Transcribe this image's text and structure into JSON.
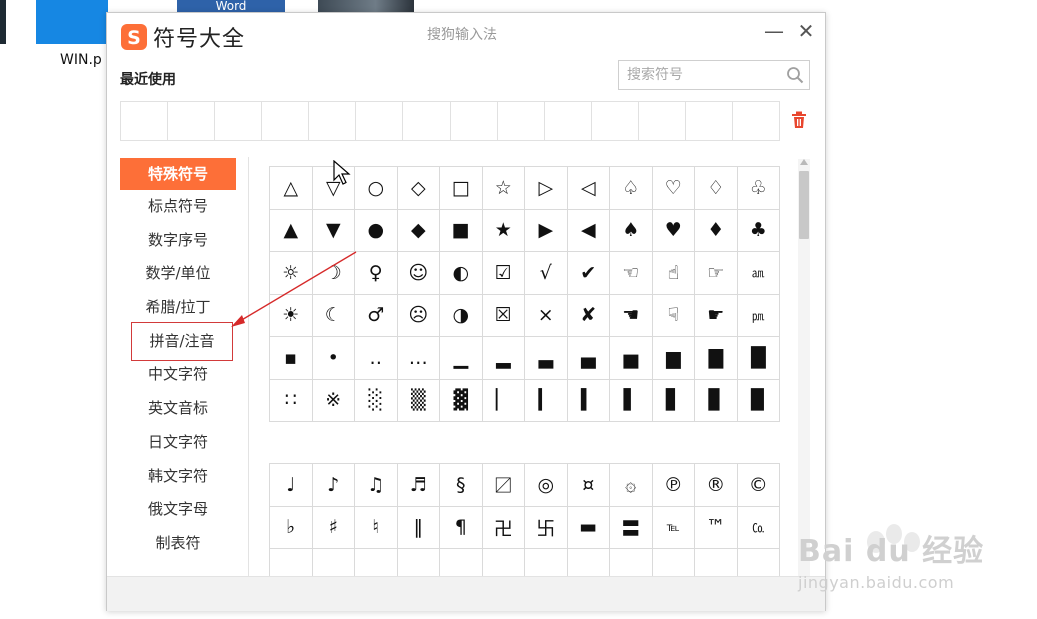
{
  "desktop": {
    "word_tile_label": "Word",
    "win_caption": "WIN.p"
  },
  "window": {
    "title": "符号大全",
    "source": "搜狗输入法",
    "minimize_label": "—",
    "close_label": "✕",
    "accent_color": "#fd6f38"
  },
  "recent": {
    "label": "最近使用",
    "cell_count": 14
  },
  "search": {
    "placeholder": "搜索符号",
    "value": ""
  },
  "categories": [
    {
      "label": "特殊符号",
      "active": true
    },
    {
      "label": "标点符号"
    },
    {
      "label": "数字序号"
    },
    {
      "label": "数学/单位"
    },
    {
      "label": "希腊/拉丁"
    },
    {
      "label": "拼音/注音",
      "highlighted": true
    },
    {
      "label": "中文字符"
    },
    {
      "label": "英文音标"
    },
    {
      "label": "日文字符"
    },
    {
      "label": "韩文字符"
    },
    {
      "label": "俄文字母"
    },
    {
      "label": "制表符"
    }
  ],
  "symbols_block1": [
    [
      "△",
      "▽",
      "○",
      "◇",
      "□",
      "☆",
      "▷",
      "◁",
      "♤",
      "♡",
      "♢",
      "♧"
    ],
    [
      "▲",
      "▼",
      "●",
      "◆",
      "■",
      "★",
      "▶",
      "◀",
      "♠",
      "♥",
      "♦",
      "♣"
    ],
    [
      "☼",
      "☽",
      "♀",
      "☺",
      "◐",
      "☑",
      "√",
      "✔",
      "☜",
      "☝",
      "☞",
      "㏂"
    ],
    [
      "☀",
      "☾",
      "♂",
      "☹",
      "◑",
      "☒",
      "×",
      "✘",
      "☚",
      "☟",
      "☛",
      "㏘"
    ],
    [
      "▪",
      "•",
      "‥",
      "…",
      "▁",
      "▂",
      "▃",
      "▄",
      "▅",
      "▆",
      "▇",
      "█"
    ],
    [
      "∷",
      "※",
      "░",
      "▒",
      "▓",
      "▏",
      "▎",
      "▍",
      "▌",
      "▋",
      "▊",
      "▉"
    ]
  ],
  "symbols_block2": [
    [
      "♩",
      "♪",
      "♫",
      "♬",
      "§",
      "〼",
      "◎",
      "¤",
      "۞",
      "℗",
      "®",
      "©"
    ],
    [
      "♭",
      "♯",
      "♮",
      "‖",
      "¶",
      "卍",
      "卐",
      "▬",
      "〓",
      "℡",
      "™",
      "㏇"
    ],
    [
      "",
      "",
      "",
      "",
      "",
      "",
      "",
      "",
      "",
      "",
      "",
      ""
    ]
  ],
  "watermark": {
    "brand": "Bai du 经验",
    "url": "jingyan.baidu.com"
  }
}
